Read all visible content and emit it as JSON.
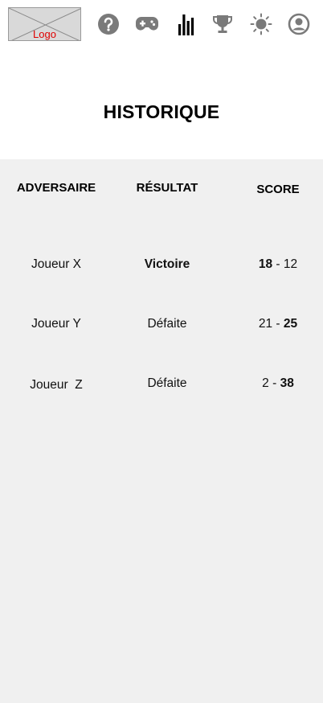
{
  "header": {
    "logo_label": "Logo",
    "nav": [
      {
        "icon": "help-icon",
        "label": "Aide"
      },
      {
        "icon": "gamepad-icon",
        "label": "Jeu"
      },
      {
        "icon": "stats-icon",
        "label": "Historique",
        "active": true
      },
      {
        "icon": "trophy-icon",
        "label": "Classement"
      },
      {
        "icon": "sun-icon",
        "label": "Thème"
      },
      {
        "icon": "account-icon",
        "label": "Profil"
      }
    ]
  },
  "title": "HISTORIQUE",
  "table": {
    "headers": [
      "ADVERSAIRE",
      "RÉSULTAT",
      "SCORE"
    ],
    "rows": [
      {
        "opponent": "Joueur X",
        "result": "Victoire",
        "result_bold": true,
        "score_left": "18",
        "score_sep": " - ",
        "score_right": "12",
        "bold_side": "left"
      },
      {
        "opponent": "Joueur Y",
        "result": "Défaite",
        "result_bold": false,
        "score_left": "21",
        "score_sep": " - ",
        "score_right": "25",
        "bold_side": "right"
      },
      {
        "opponent": "Joueur  Z",
        "result": "Défaite",
        "result_bold": false,
        "score_left": "2",
        "score_sep": " - ",
        "score_right": "38",
        "bold_side": "right"
      }
    ]
  },
  "colors": {
    "icon_gray": "#7a7a7a",
    "icon_active": "#000000",
    "panel_bg": "#f0f0f0",
    "logo_text": "#e00000"
  }
}
